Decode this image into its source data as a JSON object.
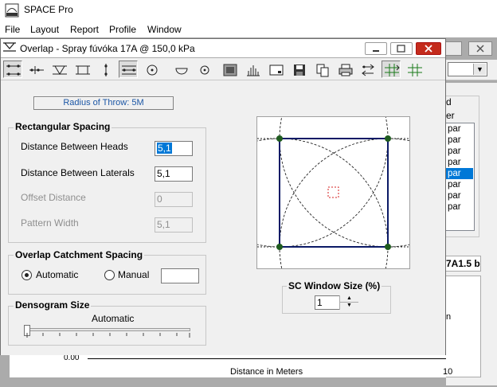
{
  "app": {
    "title": "SPACE Pro",
    "menu": [
      "File",
      "Layout",
      "Report",
      "Profile",
      "Window"
    ]
  },
  "background": {
    "list_title": "d",
    "list_subtitle": "er",
    "list_items": [
      "par",
      "par",
      "par",
      "par",
      "par",
      "par",
      "par",
      "par"
    ],
    "selected_index": 4,
    "field_value": "7A1.5 b",
    "chart_side_text": "n",
    "chart_zero": "0.00",
    "chart_xlabel": "Distance in Meters",
    "chart_xmax": "10"
  },
  "child": {
    "title": "Overlap - Spray fúvóka  17A @ 150,0 kPa",
    "radius_of_throw": "Radius of Throw: 5M",
    "rect_spacing": {
      "title": "Rectangular Spacing",
      "heads_label": "Distance Between Heads",
      "heads_value": "5,1",
      "laterals_label": "Distance Between Laterals",
      "laterals_value": "5,1",
      "offset_label": "Offset Distance",
      "offset_value": "0",
      "pattern_label": "Pattern Width",
      "pattern_value": "5,1"
    },
    "catchment": {
      "title": "Overlap Catchment Spacing",
      "automatic": "Automatic",
      "manual": "Manual",
      "manual_value": ""
    },
    "densogram": {
      "title": "Densogram Size",
      "value": "Automatic"
    },
    "sc_window": {
      "title": "SC Window Size (%)",
      "value": "1"
    }
  }
}
